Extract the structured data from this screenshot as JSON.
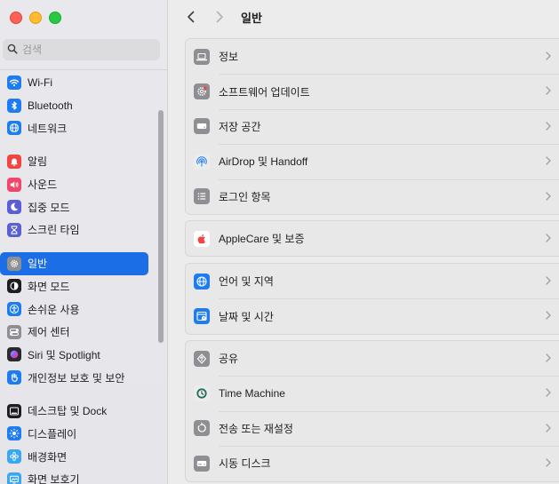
{
  "window": {
    "title": "일반"
  },
  "search": {
    "placeholder": "검색",
    "value": ""
  },
  "sidebar": {
    "groups": [
      {
        "items": [
          {
            "label": "Wi-Fi",
            "icon": "wifi-icon",
            "color": "#1e7cf2"
          },
          {
            "label": "Bluetooth",
            "icon": "bluetooth-icon",
            "color": "#1e7cf2"
          },
          {
            "label": "네트워크",
            "icon": "globe-icon",
            "color": "#1e7cf2"
          }
        ]
      },
      {
        "items": [
          {
            "label": "알림",
            "icon": "bell-icon",
            "color": "#f2453d"
          },
          {
            "label": "사운드",
            "icon": "speaker-icon",
            "color": "#f2456a"
          },
          {
            "label": "집중 모드",
            "icon": "moon-icon",
            "color": "#5b5fd6"
          },
          {
            "label": "스크린 타임",
            "icon": "hourglass-icon",
            "color": "#5b5fd6"
          }
        ]
      },
      {
        "items": [
          {
            "label": "일반",
            "icon": "gear-icon",
            "color": "#8e8e93",
            "selected": true
          },
          {
            "label": "화면 모드",
            "icon": "appearance-icon",
            "color": "#1d1d1f"
          },
          {
            "label": "손쉬운 사용",
            "icon": "accessibility-icon",
            "color": "#1e7cf2"
          },
          {
            "label": "제어 센터",
            "icon": "control-center-icon",
            "color": "#8e8e93"
          },
          {
            "label": "Siri 및 Spotlight",
            "icon": "siri-icon",
            "color": "#2a2a2e"
          },
          {
            "label": "개인정보 보호 및 보안",
            "icon": "hand-icon",
            "color": "#1e7cf2"
          }
        ]
      },
      {
        "items": [
          {
            "label": "데스크탑 및 Dock",
            "icon": "dock-icon",
            "color": "#1d1d1f"
          },
          {
            "label": "디스플레이",
            "icon": "sun-icon",
            "color": "#1e7cf2"
          },
          {
            "label": "배경화면",
            "icon": "flower-icon",
            "color": "#3aa8f0"
          },
          {
            "label": "화면 보호기",
            "icon": "screensaver-icon",
            "color": "#3aa8f0"
          }
        ]
      }
    ]
  },
  "main": {
    "cards": [
      {
        "rows": [
          {
            "label": "정보",
            "icon": "laptop-icon",
            "color": "#8e8e93"
          },
          {
            "label": "소프트웨어 업데이트",
            "icon": "gear-badge-icon",
            "color": "#8e8e93"
          },
          {
            "label": "저장 공간",
            "icon": "drive-icon",
            "color": "#8e8e93"
          },
          {
            "label": "AirDrop 및 Handoff",
            "icon": "airdrop-icon",
            "color": "#1e7cf2"
          },
          {
            "label": "로그인 항목",
            "icon": "list-icon",
            "color": "#8e8e93"
          }
        ]
      },
      {
        "rows": [
          {
            "label": "AppleCare 및 보증",
            "icon": "apple-icon",
            "color": "#f2453d"
          }
        ]
      },
      {
        "rows": [
          {
            "label": "언어 및 지역",
            "icon": "globe-icon",
            "color": "#1e7cf2"
          },
          {
            "label": "날짜 및 시간",
            "icon": "calendar-clock-icon",
            "color": "#1e7cf2"
          }
        ]
      },
      {
        "rows": [
          {
            "label": "공유",
            "icon": "share-icon",
            "color": "#8e8e93"
          },
          {
            "label": "Time Machine",
            "icon": "time-machine-icon",
            "color": "#1f6f5c"
          },
          {
            "label": "전송 또는 재설정",
            "icon": "reset-icon",
            "color": "#8e8e93"
          },
          {
            "label": "시동 디스크",
            "icon": "disk-icon",
            "color": "#8e8e93"
          }
        ]
      }
    ]
  }
}
